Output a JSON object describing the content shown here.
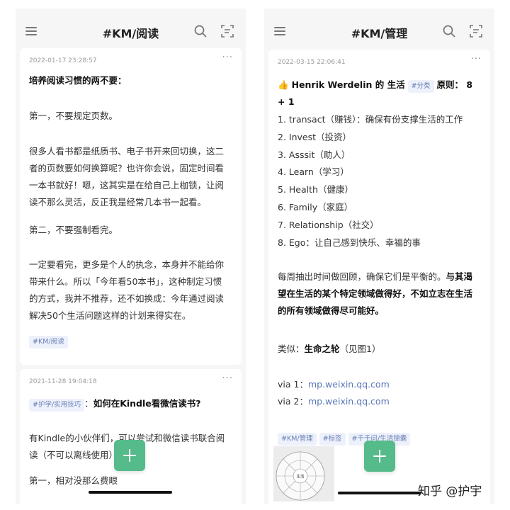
{
  "left": {
    "title": "#KM/阅读",
    "card1": {
      "time": "2022-01-17 23:28:57",
      "heading": "培养阅读习惯的两不要：",
      "p1": "第一，不要规定页数。",
      "p2_lines": [
        "很多人看书都是纸质书、电子书开来回切换，这二",
        "者的页数要如何换算呢？也许你会说，固定时间看",
        "一本书就好！嗯，这其实是在给自己上枷锁，让阅",
        "读不那么灵活，反正我是经常几本书一起看。"
      ],
      "p3": "第二，不要强制看完。",
      "p4_lines": [
        "一定要看完，更多是个人的执念，本身并不能给你",
        "带来什么。所以「今年看50本书」，这种制定习惯",
        "的方式，我并不推荐，还不如换成：今年通过阅读",
        "解决50个生活问题这样的计划来得实在。"
      ],
      "tag": "#KM/阅读"
    },
    "card2": {
      "time": "2021-11-28 19:04:18",
      "tag": "#护学/实用技巧",
      "title_sep": "：",
      "title": "如何在Kindle看微信读书?",
      "p1_lines": [
        "有Kindle的小伙伴们，可以尝试和微信读书联合阅",
        "读（不可以离线使用）"
      ],
      "p2": "第一，相对没那么费眼"
    }
  },
  "right": {
    "title": "#KM/管理",
    "card": {
      "time": "2022-03-15 22:06:41",
      "emoji": "👍",
      "heading": "Henrik Werdelin 的 生活",
      "heading_tag": "#分类",
      "heading_tail": "原则： 8 + 1",
      "list": [
        "1. transact（赚钱）：确保有份支撑生活的工作",
        "2. Invest（投资）",
        "3. Asssit（助人）",
        "4. Learn（学习）",
        "5. Health（健康）",
        "6. Family（家庭）",
        "7. Relationship（社交）",
        "8. Ego：让自己感到快乐、幸福的事"
      ],
      "para_normal": "每周抽出时间做回顾，确保它们是平衡的。",
      "para_bold_1": "与其渴",
      "para_bold_lines": [
        "望在生活的某个特定领域做得好，不如立志在生活",
        "的所有领域做得尽可能好。"
      ],
      "similar_label": "类似：",
      "similar_bold": "生命之轮",
      "similar_tail": "（见图1）",
      "via1_label": "via 1：",
      "via1_link": "mp.weixin.qq.com",
      "via2_label": "via 2：",
      "via2_link": "mp.weixin.qq.com",
      "tags": [
        "#KM/管理",
        "#标签",
        "#千千问/生活锦囊"
      ],
      "wheel_center": "生活"
    }
  },
  "watermark": "知乎 @护宇",
  "colors": {
    "accent_green": "#55bb8a",
    "tag_bg": "#edf1fb",
    "tag_text": "#6a7fb4",
    "link": "#5a78b8"
  }
}
